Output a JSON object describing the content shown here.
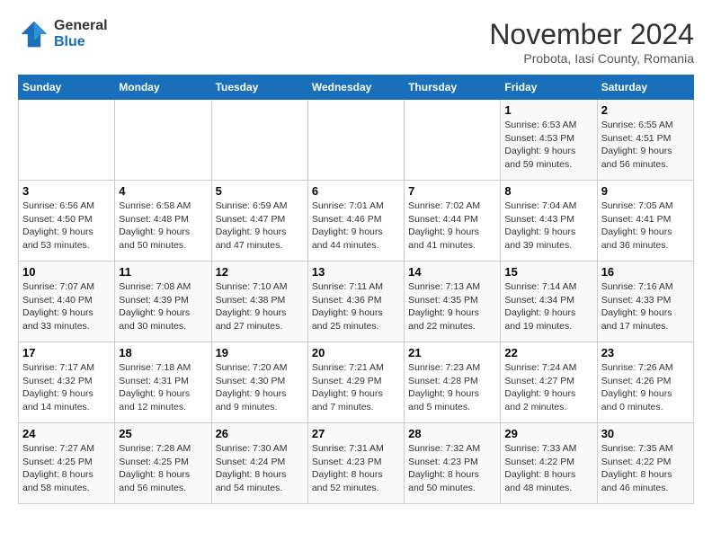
{
  "logo": {
    "line1": "General",
    "line2": "Blue"
  },
  "title": "November 2024",
  "subtitle": "Probota, Iasi County, Romania",
  "days_header": [
    "Sunday",
    "Monday",
    "Tuesday",
    "Wednesday",
    "Thursday",
    "Friday",
    "Saturday"
  ],
  "weeks": [
    [
      {
        "day": "",
        "info": ""
      },
      {
        "day": "",
        "info": ""
      },
      {
        "day": "",
        "info": ""
      },
      {
        "day": "",
        "info": ""
      },
      {
        "day": "",
        "info": ""
      },
      {
        "day": "1",
        "info": "Sunrise: 6:53 AM\nSunset: 4:53 PM\nDaylight: 9 hours and 59 minutes."
      },
      {
        "day": "2",
        "info": "Sunrise: 6:55 AM\nSunset: 4:51 PM\nDaylight: 9 hours and 56 minutes."
      }
    ],
    [
      {
        "day": "3",
        "info": "Sunrise: 6:56 AM\nSunset: 4:50 PM\nDaylight: 9 hours and 53 minutes."
      },
      {
        "day": "4",
        "info": "Sunrise: 6:58 AM\nSunset: 4:48 PM\nDaylight: 9 hours and 50 minutes."
      },
      {
        "day": "5",
        "info": "Sunrise: 6:59 AM\nSunset: 4:47 PM\nDaylight: 9 hours and 47 minutes."
      },
      {
        "day": "6",
        "info": "Sunrise: 7:01 AM\nSunset: 4:46 PM\nDaylight: 9 hours and 44 minutes."
      },
      {
        "day": "7",
        "info": "Sunrise: 7:02 AM\nSunset: 4:44 PM\nDaylight: 9 hours and 41 minutes."
      },
      {
        "day": "8",
        "info": "Sunrise: 7:04 AM\nSunset: 4:43 PM\nDaylight: 9 hours and 39 minutes."
      },
      {
        "day": "9",
        "info": "Sunrise: 7:05 AM\nSunset: 4:41 PM\nDaylight: 9 hours and 36 minutes."
      }
    ],
    [
      {
        "day": "10",
        "info": "Sunrise: 7:07 AM\nSunset: 4:40 PM\nDaylight: 9 hours and 33 minutes."
      },
      {
        "day": "11",
        "info": "Sunrise: 7:08 AM\nSunset: 4:39 PM\nDaylight: 9 hours and 30 minutes."
      },
      {
        "day": "12",
        "info": "Sunrise: 7:10 AM\nSunset: 4:38 PM\nDaylight: 9 hours and 27 minutes."
      },
      {
        "day": "13",
        "info": "Sunrise: 7:11 AM\nSunset: 4:36 PM\nDaylight: 9 hours and 25 minutes."
      },
      {
        "day": "14",
        "info": "Sunrise: 7:13 AM\nSunset: 4:35 PM\nDaylight: 9 hours and 22 minutes."
      },
      {
        "day": "15",
        "info": "Sunrise: 7:14 AM\nSunset: 4:34 PM\nDaylight: 9 hours and 19 minutes."
      },
      {
        "day": "16",
        "info": "Sunrise: 7:16 AM\nSunset: 4:33 PM\nDaylight: 9 hours and 17 minutes."
      }
    ],
    [
      {
        "day": "17",
        "info": "Sunrise: 7:17 AM\nSunset: 4:32 PM\nDaylight: 9 hours and 14 minutes."
      },
      {
        "day": "18",
        "info": "Sunrise: 7:18 AM\nSunset: 4:31 PM\nDaylight: 9 hours and 12 minutes."
      },
      {
        "day": "19",
        "info": "Sunrise: 7:20 AM\nSunset: 4:30 PM\nDaylight: 9 hours and 9 minutes."
      },
      {
        "day": "20",
        "info": "Sunrise: 7:21 AM\nSunset: 4:29 PM\nDaylight: 9 hours and 7 minutes."
      },
      {
        "day": "21",
        "info": "Sunrise: 7:23 AM\nSunset: 4:28 PM\nDaylight: 9 hours and 5 minutes."
      },
      {
        "day": "22",
        "info": "Sunrise: 7:24 AM\nSunset: 4:27 PM\nDaylight: 9 hours and 2 minutes."
      },
      {
        "day": "23",
        "info": "Sunrise: 7:26 AM\nSunset: 4:26 PM\nDaylight: 9 hours and 0 minutes."
      }
    ],
    [
      {
        "day": "24",
        "info": "Sunrise: 7:27 AM\nSunset: 4:25 PM\nDaylight: 8 hours and 58 minutes."
      },
      {
        "day": "25",
        "info": "Sunrise: 7:28 AM\nSunset: 4:25 PM\nDaylight: 8 hours and 56 minutes."
      },
      {
        "day": "26",
        "info": "Sunrise: 7:30 AM\nSunset: 4:24 PM\nDaylight: 8 hours and 54 minutes."
      },
      {
        "day": "27",
        "info": "Sunrise: 7:31 AM\nSunset: 4:23 PM\nDaylight: 8 hours and 52 minutes."
      },
      {
        "day": "28",
        "info": "Sunrise: 7:32 AM\nSunset: 4:23 PM\nDaylight: 8 hours and 50 minutes."
      },
      {
        "day": "29",
        "info": "Sunrise: 7:33 AM\nSunset: 4:22 PM\nDaylight: 8 hours and 48 minutes."
      },
      {
        "day": "30",
        "info": "Sunrise: 7:35 AM\nSunset: 4:22 PM\nDaylight: 8 hours and 46 minutes."
      }
    ]
  ]
}
